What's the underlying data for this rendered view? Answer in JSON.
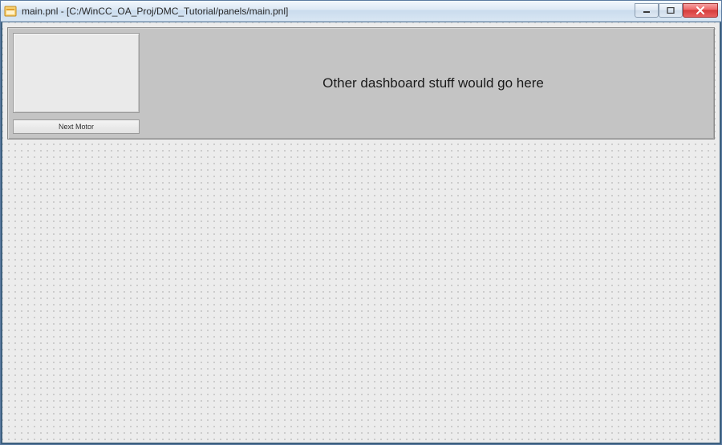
{
  "window": {
    "title": "main.pnl - [C:/WinCC_OA_Proj/DMC_Tutorial/panels/main.pnl]"
  },
  "panel": {
    "placeholder_text": "Other dashboard stuff would go here",
    "next_motor_label": "Next Motor"
  }
}
